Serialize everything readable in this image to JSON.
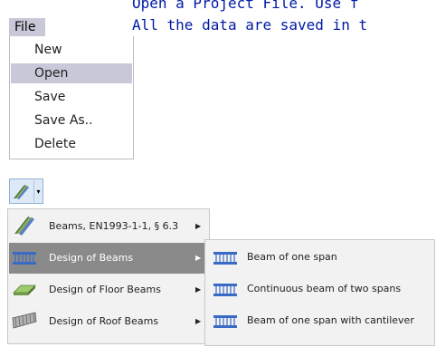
{
  "doc": {
    "line1": "Open a Project File.  Use f",
    "line2": "All the data are saved in t"
  },
  "file_menu": {
    "title": "File",
    "items": [
      {
        "label": "New"
      },
      {
        "label": "Open",
        "selected": true
      },
      {
        "label": "Save"
      },
      {
        "label": "Save As.."
      },
      {
        "label": "Delete"
      }
    ]
  },
  "toolbar": {
    "icon": "beam-tool-icon",
    "dropdown_glyph": "▾"
  },
  "menu": {
    "items": [
      {
        "label": "Beams,  EN1993-1-1, § 6.3",
        "icon": "beam-section-icon"
      },
      {
        "label": "Design of Beams",
        "icon": "beam-grid-icon",
        "selected": true
      },
      {
        "label": "Design of Floor Beams",
        "icon": "floor-slab-icon"
      },
      {
        "label": "Design of Roof Beams",
        "icon": "roof-deck-icon"
      }
    ],
    "arrow_glyph": "▶"
  },
  "submenu": {
    "items": [
      {
        "label": "Beam of one span",
        "icon": "beam-grid-icon"
      },
      {
        "label": "Continuous beam of two spans",
        "icon": "beam-grid-icon"
      },
      {
        "label": "Beam of one span with cantilever",
        "icon": "beam-grid-icon"
      }
    ]
  },
  "colors": {
    "menu_highlight": "#c8c8d8",
    "cascade_highlight": "#8a8a8a",
    "doc_text": "#001aa6"
  }
}
